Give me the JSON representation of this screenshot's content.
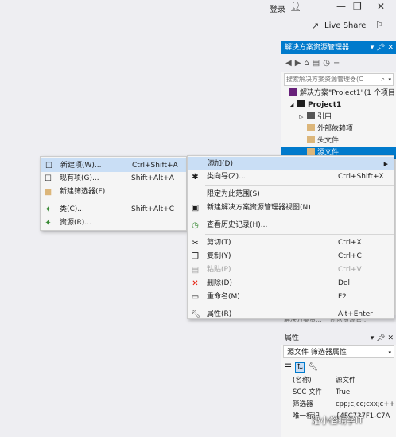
{
  "titlebar": {
    "login": "登录",
    "live_share": "Live Share"
  },
  "solution_explorer": {
    "title": "解决方案资源管理器",
    "search_placeholder": "搜索解决方案资源管理器(C",
    "tree": [
      {
        "label": "解决方案\"Project1\"(1 个项目",
        "indent": 0
      },
      {
        "label": "Project1",
        "indent": 1
      },
      {
        "label": "引用",
        "indent": 2
      },
      {
        "label": "外部依赖项",
        "indent": 2
      },
      {
        "label": "头文件",
        "indent": 2
      },
      {
        "label": "源文件",
        "indent": 2
      }
    ],
    "bottom_tabs": [
      "解决方案资...",
      "团队资源管..."
    ]
  },
  "properties": {
    "title": "属性",
    "object": "源文件  筛选器属性",
    "rows": [
      {
        "key": "(名称)",
        "value": "源文件"
      },
      {
        "key": "SCC 文件",
        "value": "True"
      },
      {
        "key": "筛选器",
        "value": "cpp;c;cc;cxx;c++"
      },
      {
        "key": "唯一标识",
        "value": "{4FC737F1-C7A"
      }
    ]
  },
  "submenu": {
    "items": [
      {
        "label": "新建项(W)...",
        "shortcut": "Ctrl+Shift+A"
      },
      {
        "label": "现有项(G)...",
        "shortcut": "Shift+Alt+A"
      },
      {
        "label": "新建筛选器(F)",
        "shortcut": ""
      },
      {
        "label": "类(C)...",
        "shortcut": "Shift+Alt+C"
      },
      {
        "label": "资源(R)...",
        "shortcut": ""
      }
    ]
  },
  "context_menu": {
    "items": [
      {
        "label": "添加(D)",
        "shortcut": ""
      },
      {
        "label": "类向导(Z)...",
        "shortcut": "Ctrl+Shift+X"
      },
      {
        "label": "限定为此范围(S)",
        "shortcut": ""
      },
      {
        "label": "新建解决方案资源管理器视图(N)",
        "shortcut": ""
      },
      {
        "label": "查看历史记录(H)...",
        "shortcut": ""
      },
      {
        "label": "剪切(T)",
        "shortcut": "Ctrl+X"
      },
      {
        "label": "复制(Y)",
        "shortcut": "Ctrl+C"
      },
      {
        "label": "粘贴(P)",
        "shortcut": "Ctrl+V"
      },
      {
        "label": "删除(D)",
        "shortcut": "Del"
      },
      {
        "label": "重命名(M)",
        "shortcut": "F2"
      },
      {
        "label": "属性(R)",
        "shortcut": "Alt+Enter"
      }
    ]
  },
  "watermark": "潘小俗睛学IT",
  "colors": {
    "accent": "#007acc",
    "highlight": "#c9def5",
    "delete_icon": "#e51400"
  }
}
